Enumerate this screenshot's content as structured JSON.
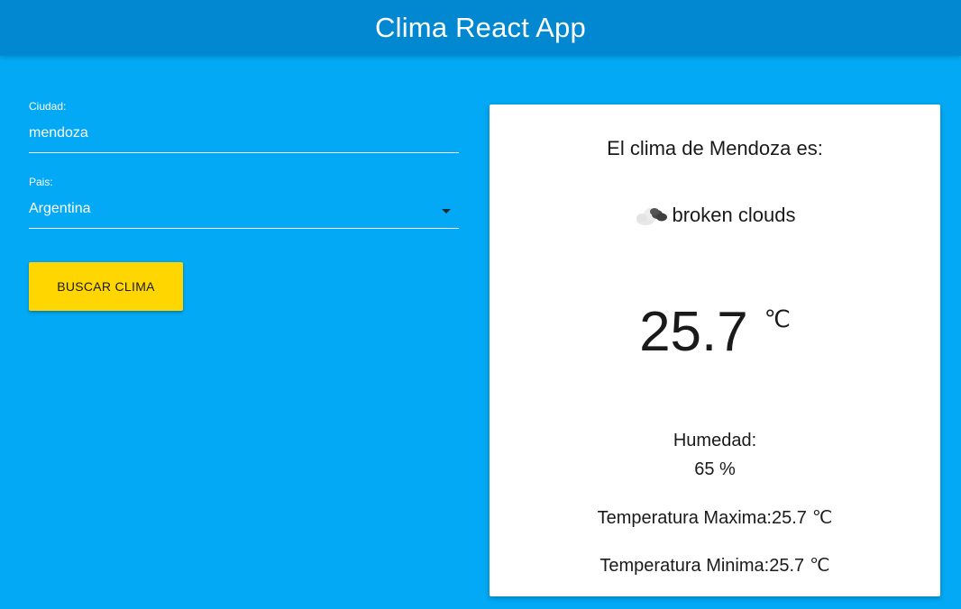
{
  "app": {
    "title": "Clima React App"
  },
  "form": {
    "city": {
      "label": "Ciudad:",
      "value": "mendoza"
    },
    "country": {
      "label": "Pais:",
      "selected": "Argentina"
    },
    "search_button": "BUSCAR CLIMA"
  },
  "weather": {
    "heading": "El clima de Mendoza es:",
    "condition_icon": "cloud-icon",
    "condition": "broken clouds",
    "temperature": "25.7",
    "unit": "℃",
    "humidity_label": "Humedad:",
    "humidity_value": "65 %",
    "max_label": "Temperatura Maxima:25.7",
    "min_label": "Temperatura Minima:25.7"
  },
  "colors": {
    "background": "#03a9f4",
    "app_bar": "#0288d1",
    "button": "#ffd600",
    "card": "#ffffff"
  }
}
